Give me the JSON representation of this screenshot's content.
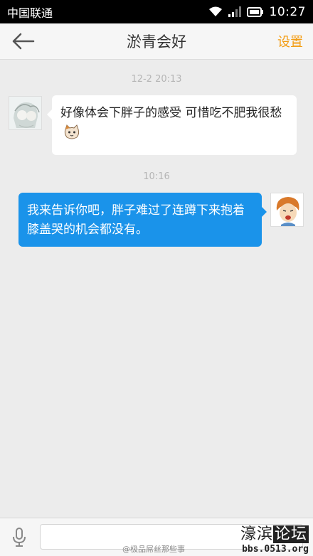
{
  "status_bar": {
    "carrier": "中国联通",
    "time": "10:27"
  },
  "header": {
    "title": "淤青会好",
    "settings_label": "设置"
  },
  "messages": [
    {
      "timestamp": "12-2 20:13",
      "direction": "incoming",
      "text": "好像体会下胖子的感受 可惜吃不肥我很愁"
    },
    {
      "timestamp": "10:16",
      "direction": "outgoing",
      "text": "我来告诉你吧，胖子难过了连蹲下来抱着膝盖哭的机会都没有。"
    }
  ],
  "input": {
    "value": "",
    "placeholder": ""
  },
  "watermark": {
    "site_name_left": "濠滨",
    "site_name_right": "论坛",
    "site_url": "bbs.0513.org",
    "weibo_credit": "@极品屌丝那些事"
  },
  "colors": {
    "accent": "#f39c12",
    "outgoing_bubble": "#1a93ea",
    "background": "#ececec"
  }
}
